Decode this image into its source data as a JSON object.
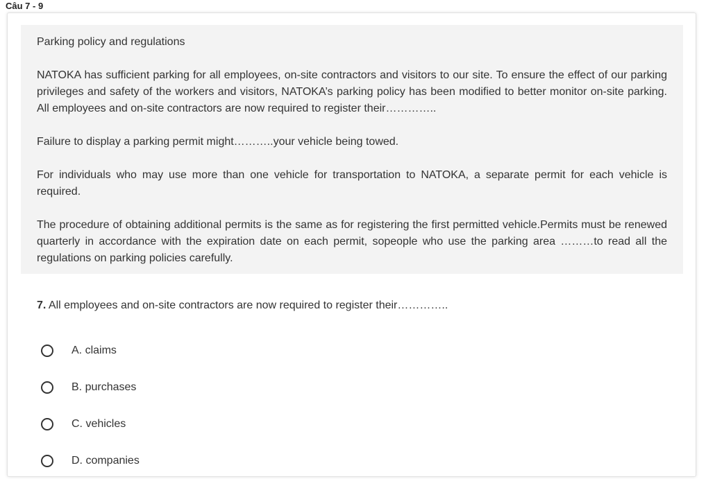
{
  "header": {
    "title": "Câu 7 - 9"
  },
  "passage": {
    "title": "Parking policy and regulations",
    "paragraphs": [
      "NATOKA has sufficient parking for all employees, on-site contractors and visitors to our site. To ensure the effect of our parking privileges and safety of the workers and visitors, NATOKA’s parking policy has been modified to better monitor on-site parking. All employees and on-site contractors are now required to register their…………..",
      "Failure to display a parking permit might………..your vehicle being towed.",
      "For individuals who may use more than one vehicle for transportation to NATOKA, a separate permit for each vehicle is required.",
      "The procedure of obtaining additional permits is the same as for registering the first permitted vehicle.Permits must be renewed quarterly in accordance with the expiration date on each permit, sopeople who use the parking area ………to read all the regulations on parking policies carefully."
    ]
  },
  "question": {
    "number": "7.",
    "text": "All employees and on-site contractors are now required to register their…………..",
    "options": [
      {
        "label": "A. claims"
      },
      {
        "label": "B. purchases"
      },
      {
        "label": "C. vehicles"
      },
      {
        "label": "D. companies"
      }
    ]
  }
}
